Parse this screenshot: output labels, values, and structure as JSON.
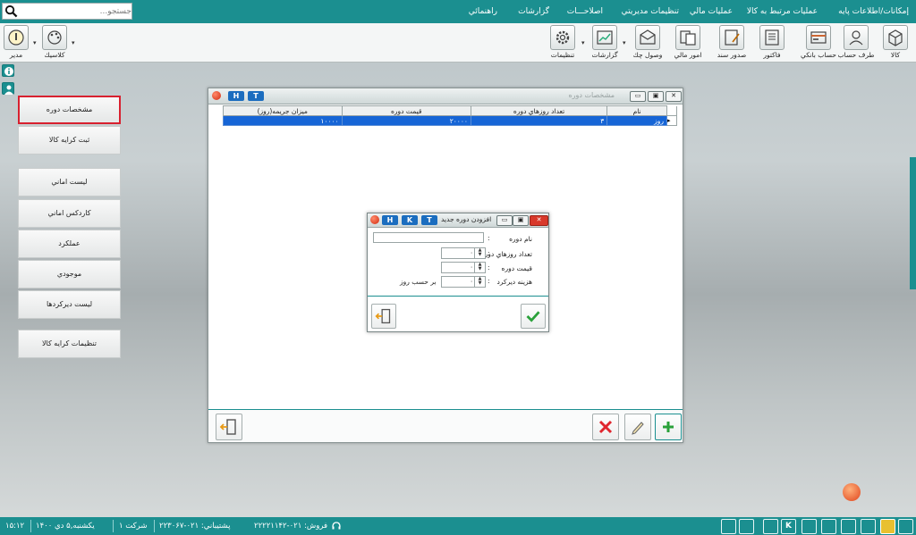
{
  "menu": {
    "items": [
      "إمكانات/اطلاعات پايه",
      "عمليات مرتبط به كالا",
      "عمليات مالي",
      "تنظيمات مديريتي",
      "اصلاحـــات",
      "گزارشات",
      "راهنمائي"
    ]
  },
  "search": {
    "placeholder": "جستجو..."
  },
  "toolbar": {
    "right_buttons": [
      "كالا",
      "طرف حساب",
      "حساب بانكي",
      "فاكتور",
      "صدور سند",
      "امور مالي",
      "وصول چك",
      "گزارشات",
      "تنظيمات"
    ],
    "left_buttons": [
      "كلاسيك",
      "مدير"
    ]
  },
  "left_panel": {
    "buttons": [
      "مشخصات دوره",
      "ثبت كرايه كالا",
      "ليست اماني",
      "كاردكس اماني",
      "عملكرد",
      "موجودي",
      "ليست ديركردها",
      "تنظيمات كرايه كالا"
    ]
  },
  "main_window": {
    "title": "مشخصات دوره",
    "title_buttons": [
      "H",
      "T"
    ],
    "columns": [
      "نام",
      "تعداد روزهاي دوره",
      "قيمت دوره",
      "ميزان جريمه(روز)"
    ],
    "rows": [
      [
        "روز",
        "۳",
        "۲۰۰۰۰",
        "۱۰۰۰۰"
      ]
    ]
  },
  "dialog": {
    "title": "افزودن دوره جديد",
    "title_buttons": [
      "H",
      "K",
      "T"
    ],
    "fields": {
      "name_label": "نام دوره",
      "days_label": "تعداد روزهاي دوره",
      "price_label": "قيمت دوره",
      "delay_label": "هزينه ديركرد",
      "per_day_label": "بر حسب روز",
      "colon": ":"
    },
    "values": {
      "days": "۰",
      "price": "۰",
      "delay": "۰"
    }
  },
  "status": {
    "time": "۱۵:۱۲",
    "date": "يكشنبه,۵ دي ۱۴۰۰",
    "company": "شركت ۱",
    "support": "پشتيباني: ۰۲۱-۲۲۳۰۶۷",
    "sales": "فروش: ۰۲۱-۲۲۲۲۱۱۴۲"
  },
  "colors": {
    "teal": "#1b8f90",
    "selection": "#1665d6",
    "active_border": "#d8202f",
    "confirm": "#2aa13a",
    "cancel": "#e0262e"
  }
}
